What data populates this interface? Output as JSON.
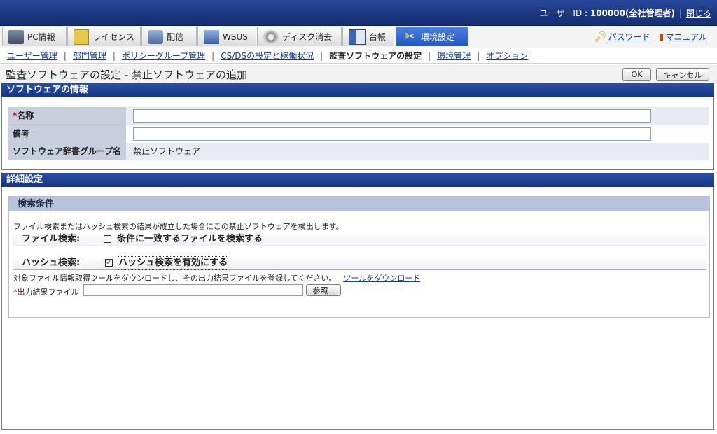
{
  "header": {
    "user_label": "ユーザーID : ",
    "user_value": "100000(全社管理者)",
    "close_link": "閉じる"
  },
  "tabs": [
    {
      "label": "PC情報",
      "icon": "pc-icon"
    },
    {
      "label": "ライセンス",
      "icon": "license-icon"
    },
    {
      "label": "配信",
      "icon": "distribution-icon"
    },
    {
      "label": "WSUS",
      "icon": "wsus-icon"
    },
    {
      "label": "ディスク消去",
      "icon": "disk-erase-icon"
    },
    {
      "label": "台帳",
      "icon": "ledger-icon"
    },
    {
      "label": "環境設定",
      "icon": "settings-tools-icon",
      "active": true
    }
  ],
  "top_links": {
    "password": "パスワード",
    "manual": "マニュアル"
  },
  "subnav": [
    {
      "label": "ユーザー管理"
    },
    {
      "label": "部門管理"
    },
    {
      "label": "ポリシーグループ管理"
    },
    {
      "label": "CS/DSの設定と稼働状況"
    },
    {
      "label": "監査ソフトウェアの設定",
      "current": true
    },
    {
      "label": "環境管理"
    },
    {
      "label": "オプション"
    }
  ],
  "page": {
    "title": "監査ソフトウェアの設定 - 禁止ソフトウェアの追加",
    "ok_button": "OK",
    "cancel_button": "キャンセル"
  },
  "software_info": {
    "section_title": "ソフトウェアの情報",
    "name_required_mark": "*",
    "name_label": "名称",
    "name_value": "",
    "remarks_label": "備考",
    "remarks_value": "",
    "dict_group_label": "ソフトウェア辞書グループ名",
    "dict_group_value": "禁止ソフトウェア"
  },
  "details": {
    "section_title": "詳細設定",
    "search_panel_title": "検索条件",
    "description": "ファイル検索またはハッシュ検索の結果が成立した場合にこの禁止ソフトウェアを検出します。",
    "file_search_label": "ファイル検索:",
    "file_search_checkbox": "条件に一致するファイルを検索する",
    "file_search_checked": false,
    "hash_search_label": "ハッシュ検索:",
    "hash_search_checkbox": "ハッシュ検索を有効にする",
    "hash_search_checked": true,
    "hash_note": "対象ファイル情報取得ツールをダウンロードし、その出力結果ファイルを登録してください。",
    "download_link": "ツールをダウンロード",
    "output_required_mark": "*",
    "output_file_label": "出力結果ファイル",
    "output_file_value": "",
    "browse_button": "参照..."
  }
}
